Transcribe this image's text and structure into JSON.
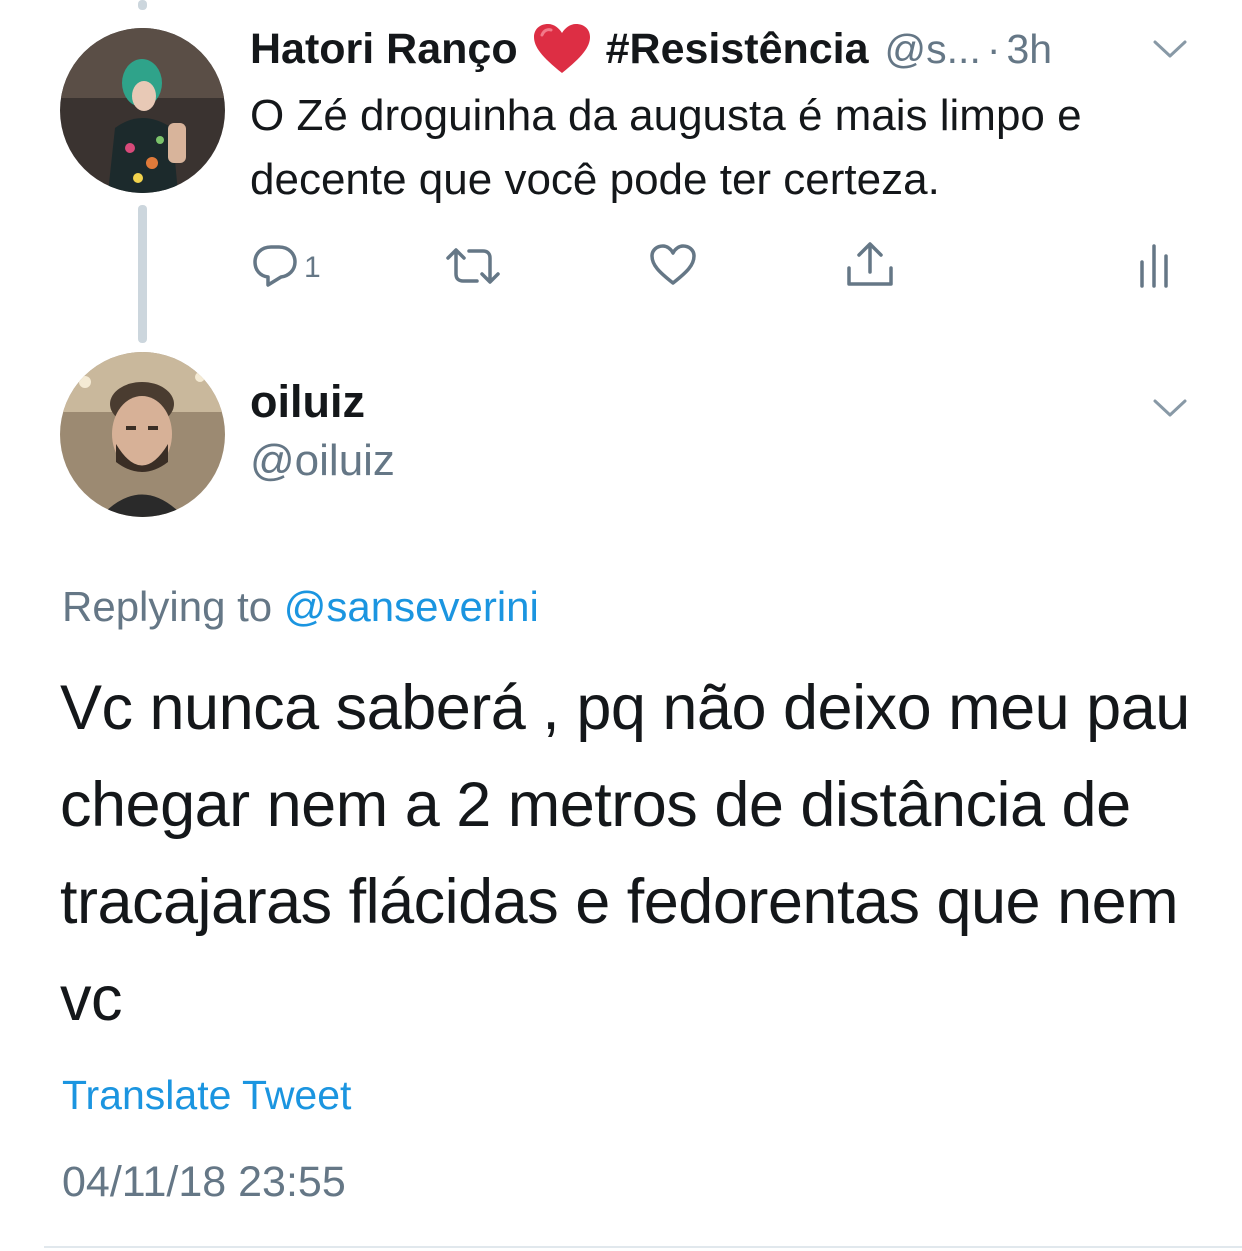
{
  "parent_tweet": {
    "display_name": "Hatori Ranço",
    "hashtag": "#Resistência",
    "handle": "@s...",
    "separator": "·",
    "time": "3h",
    "text": "O Zé droguinha da augusta é mais limpo e decente que você pode ter certeza.",
    "actions": {
      "reply_count": "1",
      "retweet_count": "",
      "like_count": ""
    }
  },
  "reply_tweet": {
    "display_name": "oiluiz",
    "handle": "@oiluiz",
    "replying_prefix": "Replying to",
    "replying_to": "@sanseverini",
    "text": "Vc nunca saberá , pq não deixo meu pau chegar nem a 2 metros de distância de tracajaras flácidas e fedorentas que nem vc",
    "translate_label": "Translate Tweet",
    "timestamp": "04/11/18 23:55"
  },
  "colors": {
    "text": "#14171a",
    "secondary": "#657786",
    "link": "#1b95e0",
    "thread_line": "#ccd6dd",
    "heart_emoji": "#dd2e44"
  },
  "icons": [
    "reply-icon",
    "retweet-icon",
    "like-icon",
    "share-icon",
    "analytics-icon",
    "chevron-down-icon",
    "red-heart-emoji"
  ]
}
